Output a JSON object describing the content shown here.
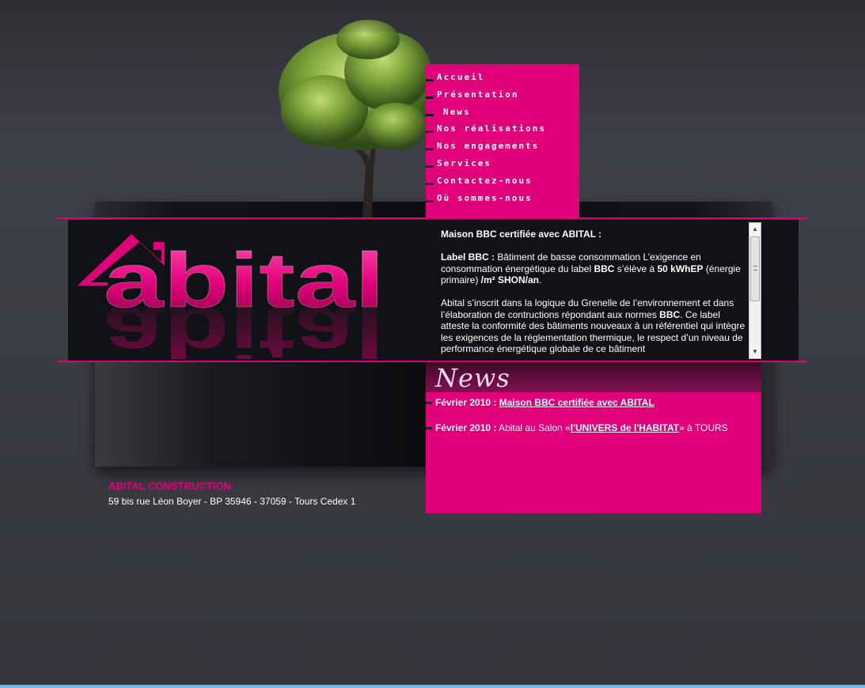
{
  "colors": {
    "accent": "#e2007a",
    "background": "#3b3d44",
    "panel": "#111215"
  },
  "nav": {
    "items": [
      {
        "label": "Accueil"
      },
      {
        "label": "Présentation"
      },
      {
        "label": "News"
      },
      {
        "label": "Nos réalisations"
      },
      {
        "label": "Nos engagements"
      },
      {
        "label": "Services"
      },
      {
        "label": "Contactez-nous"
      },
      {
        "label": "Où sommes-nous"
      }
    ]
  },
  "logo": {
    "text": "abital"
  },
  "article": {
    "title": "Maison BBC certifiée avec ABITAL :",
    "p1_label": "Label BBC :",
    "p1_text_a": " Bâtiment de basse consommation L’exigence en consommation énergétique du label ",
    "p1_bbc": "BBC",
    "p1_text_b": " s’élève à ",
    "p1_value": "50 kWhEP",
    "p1_text_c": " (énergie primaire) ",
    "p1_unit": "/m² SHON/an",
    "p1_end": ".",
    "p2_text_a": "Abital s’inscrit dans la logique du Grenelle de l’environnement et dans l’élaboration de contructions répondant aux normes ",
    "p2_bbc": "BBC",
    "p2_text_b": ". Ce label atteste la conformité des bâtiments nouveaux à un référentiel qui intègre les exigences de la réglementation thermique, le respect d’un niveau de performance énergétique globale de ce bâtiment"
  },
  "news": {
    "title": "News",
    "items": [
      {
        "date": "Février 2010 :",
        "prefix": "",
        "link": "Maison BBC certifiée avec ABITAL",
        "suffix": ""
      },
      {
        "date": "Février 2010 :",
        "prefix": "Abital au Salon «",
        "link": "l'UNIVERS de l'HABITAT",
        "suffix": "» à TOURS"
      }
    ]
  },
  "footer": {
    "company": "ABITAL CONSTRUCTION",
    "address": "59 bis rue Léon Boyer - BP 35946 - 37059 - Tours Cedex 1"
  }
}
